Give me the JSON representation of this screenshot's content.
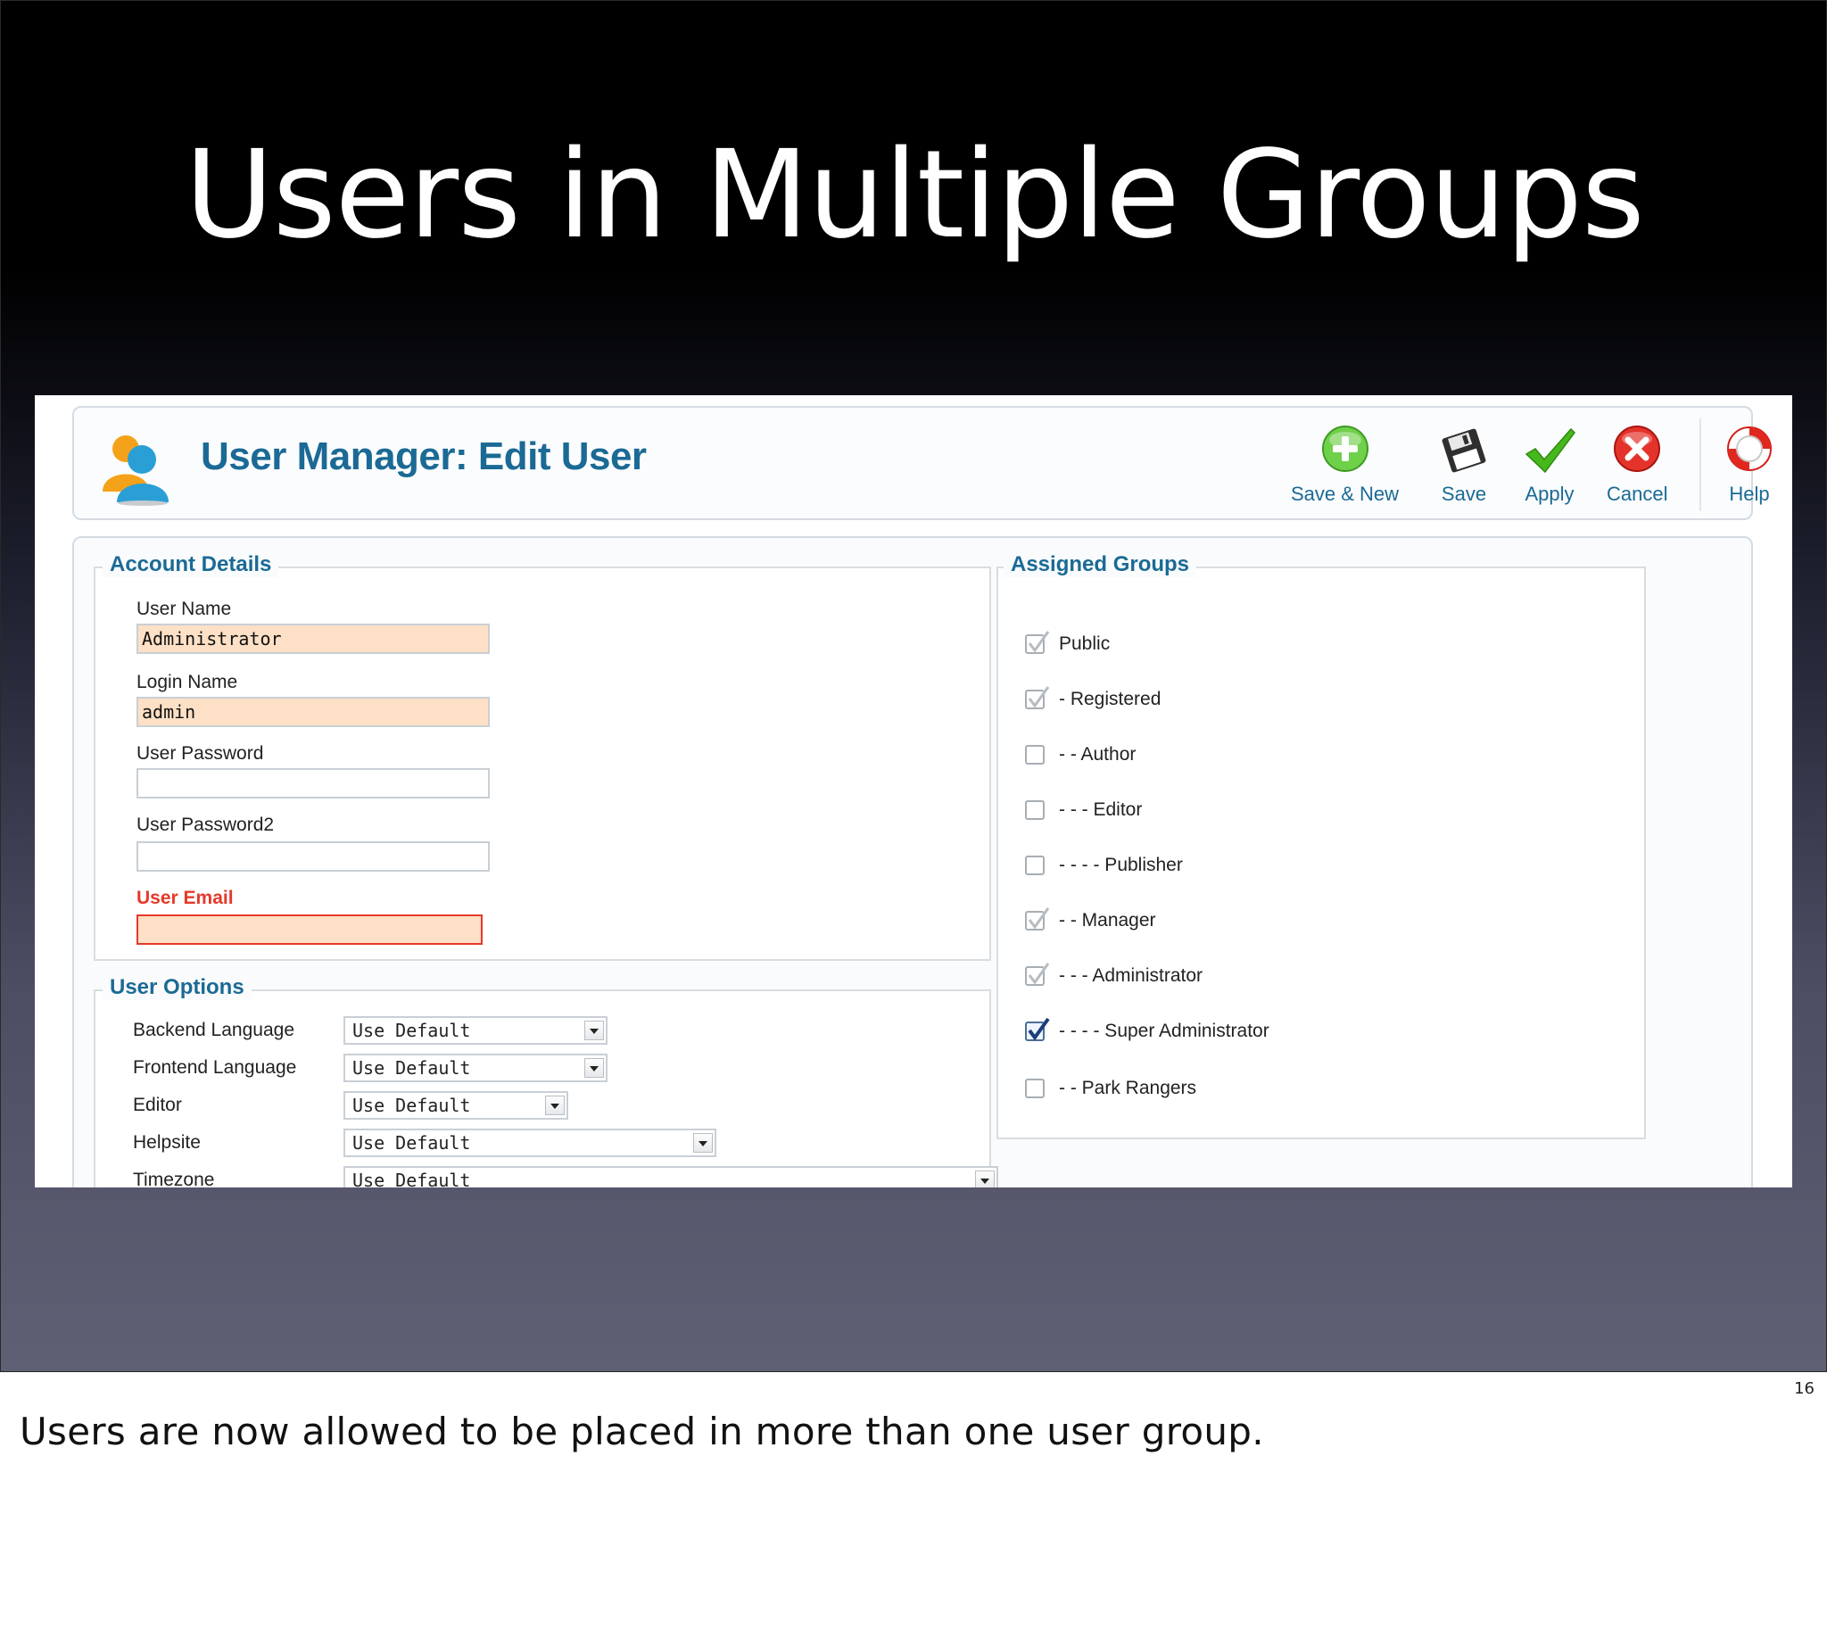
{
  "slide": {
    "title": "Users in Multiple Groups",
    "number": "16",
    "notes": "Users are now allowed to be placed in more than one user group."
  },
  "header": {
    "title": "User Manager: Edit User",
    "icon": "users-icon"
  },
  "toolbar": [
    {
      "label": "Save & New",
      "icon": "plus-circle-icon",
      "color": "#5cc23a"
    },
    {
      "label": "Save",
      "icon": "floppy-disk-icon",
      "color": "#3a3a3a"
    },
    {
      "label": "Apply",
      "icon": "checkmark-icon",
      "color": "#43b51a"
    },
    {
      "label": "Cancel",
      "icon": "x-circle-icon",
      "color": "#e0281f"
    },
    {
      "label": "Help",
      "icon": "lifebuoy-icon",
      "color": "#e0281f"
    }
  ],
  "account": {
    "legend": "Account Details",
    "fields": [
      {
        "label": "User Name",
        "value": "Administrator"
      },
      {
        "label": "Login Name",
        "value": "admin"
      },
      {
        "label": "User Password",
        "value": ""
      },
      {
        "label": "User Password2",
        "value": ""
      },
      {
        "label": "User Email",
        "value": ""
      }
    ]
  },
  "options": {
    "legend": "User Options",
    "rows": [
      {
        "label": "Backend Language",
        "value": "Use Default"
      },
      {
        "label": "Frontend Language",
        "value": "Use Default"
      },
      {
        "label": "Editor",
        "value": "Use Default"
      },
      {
        "label": "Helpsite",
        "value": "Use Default"
      },
      {
        "label": "Timezone",
        "value": "Use Default"
      }
    ]
  },
  "groups": {
    "legend": "Assigned Groups",
    "items": [
      {
        "label": "Public",
        "checked": true,
        "disabled": true
      },
      {
        "label": "- Registered",
        "checked": true,
        "disabled": true
      },
      {
        "label": "- - Author",
        "checked": false,
        "disabled": false
      },
      {
        "label": "- - - Editor",
        "checked": false,
        "disabled": false
      },
      {
        "label": "- - - - Publisher",
        "checked": false,
        "disabled": false
      },
      {
        "label": "- - Manager",
        "checked": true,
        "disabled": true
      },
      {
        "label": "- - - Administrator",
        "checked": true,
        "disabled": true
      },
      {
        "label": "- - - - Super Administrator",
        "checked": true,
        "disabled": false
      },
      {
        "label": "- - Park Rangers",
        "checked": false,
        "disabled": false
      }
    ]
  },
  "colors": {
    "accent": "#1b6a95",
    "error": "#e53a2a",
    "filled_field": "#fde0c5"
  }
}
